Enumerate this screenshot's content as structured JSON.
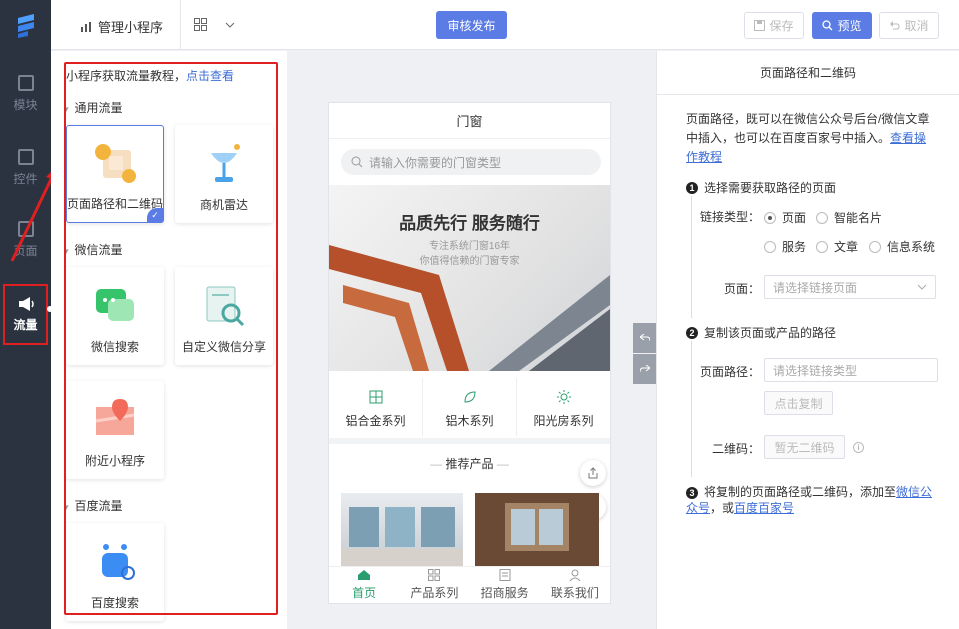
{
  "rail": {
    "items": [
      {
        "label": "模块",
        "icon": "module-icon"
      },
      {
        "label": "控件",
        "icon": "widget-icon"
      },
      {
        "label": "页面",
        "icon": "page-icon"
      },
      {
        "label": "流量",
        "icon": "megaphone-icon"
      }
    ]
  },
  "topbar": {
    "manage_label": "管理小程序",
    "publish_label": "审核发布",
    "save_label": "保存",
    "preview_label": "预览",
    "undo_label": "取消"
  },
  "panel": {
    "tutorial_text": "小程序获取流量教程，",
    "tutorial_link": "点击查看",
    "sections": {
      "general": "通用流量",
      "wechat": "微信流量",
      "baidu": "百度流量"
    },
    "cards": {
      "path_qr": "页面路径和二维码",
      "radar": "商机雷达",
      "wechat_search": "微信搜索",
      "wechat_share": "自定义微信分享",
      "nearby": "附近小程序",
      "baidu_search": "百度搜索"
    }
  },
  "phone": {
    "title": "门窗",
    "search_placeholder": "请输入你需要的门窗类型",
    "banner_title": "品质先行 服务随行",
    "banner_sub1": "专注系统门窗16年",
    "banner_sub2": "你值得信赖的门窗专家",
    "categories": [
      "铝合金系列",
      "铝木系列",
      "阳光房系列"
    ],
    "recommend_title": "推荐产品",
    "tabs": [
      "首页",
      "产品系列",
      "招商服务",
      "联系我们"
    ]
  },
  "right": {
    "header": "页面路径和二维码",
    "intro": "页面路径，既可以在微信公众号后台/微信文章中插入，也可以在百度百家号中插入。",
    "intro_link": "查看操作教程",
    "step1": "选择需要获取路径的页面",
    "link_type_label": "链接类型：",
    "options": [
      "页面",
      "智能名片",
      "服务",
      "文章",
      "信息系统"
    ],
    "page_label": "页面：",
    "page_placeholder": "请选择链接页面",
    "step2": "复制该页面或产品的路径",
    "path_label": "页面路径：",
    "path_placeholder": "请选择链接类型",
    "copy_button": "点击复制",
    "qr_label": "二维码：",
    "qr_button": "暂无二维码",
    "step3_prefix": "将复制的页面路径或二维码，添加至",
    "step3_link1": "微信公众号",
    "step3_mid": "，或",
    "step3_link2": "百度百家号"
  },
  "colors": {
    "accent": "#5b7be5",
    "rail": "#2b3240",
    "red_annotation": "#e02020"
  }
}
